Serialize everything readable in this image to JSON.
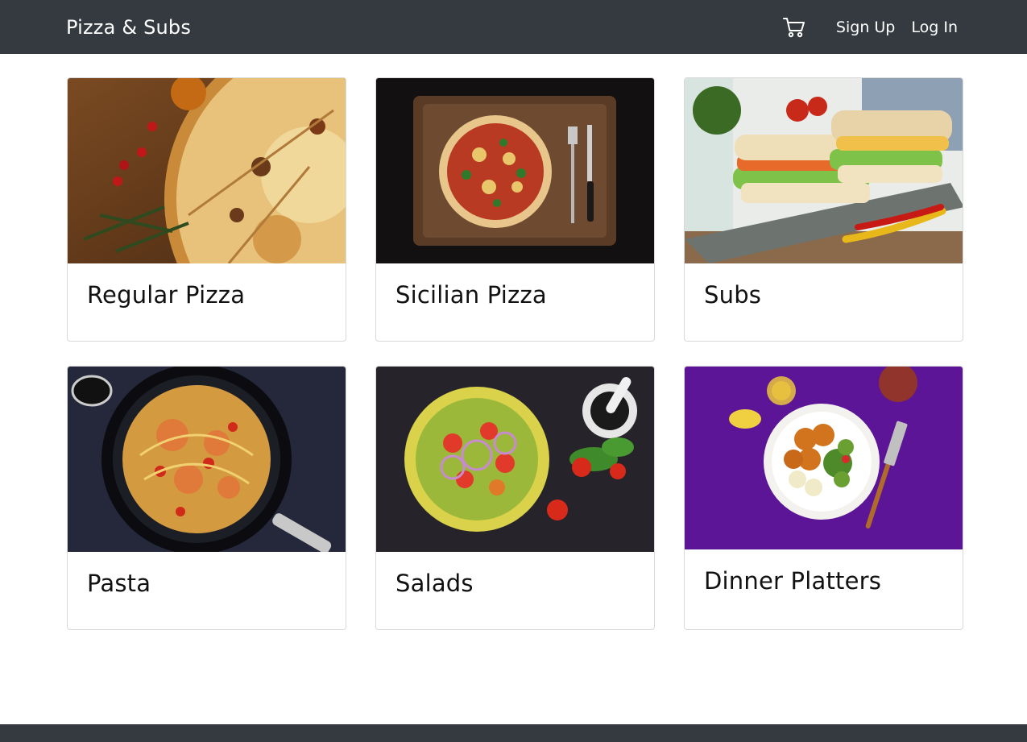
{
  "navbar": {
    "brand": "Pizza & Subs",
    "cart_icon": "shopping-cart-icon",
    "links": [
      "Sign Up",
      "Log In"
    ]
  },
  "categories": [
    {
      "title": "Regular Pizza",
      "image": "regular-pizza-photo"
    },
    {
      "title": "Sicilian Pizza",
      "image": "sicilian-pizza-photo"
    },
    {
      "title": "Subs",
      "image": "subs-photo"
    },
    {
      "title": "Pasta",
      "image": "pasta-photo"
    },
    {
      "title": "Salads",
      "image": "salads-photo"
    },
    {
      "title": "Dinner Platters",
      "image": "dinner-platters-photo"
    }
  ],
  "colors": {
    "navbar": "#343a40",
    "footer": "#343a40",
    "card_border": "#d9d9d9"
  }
}
